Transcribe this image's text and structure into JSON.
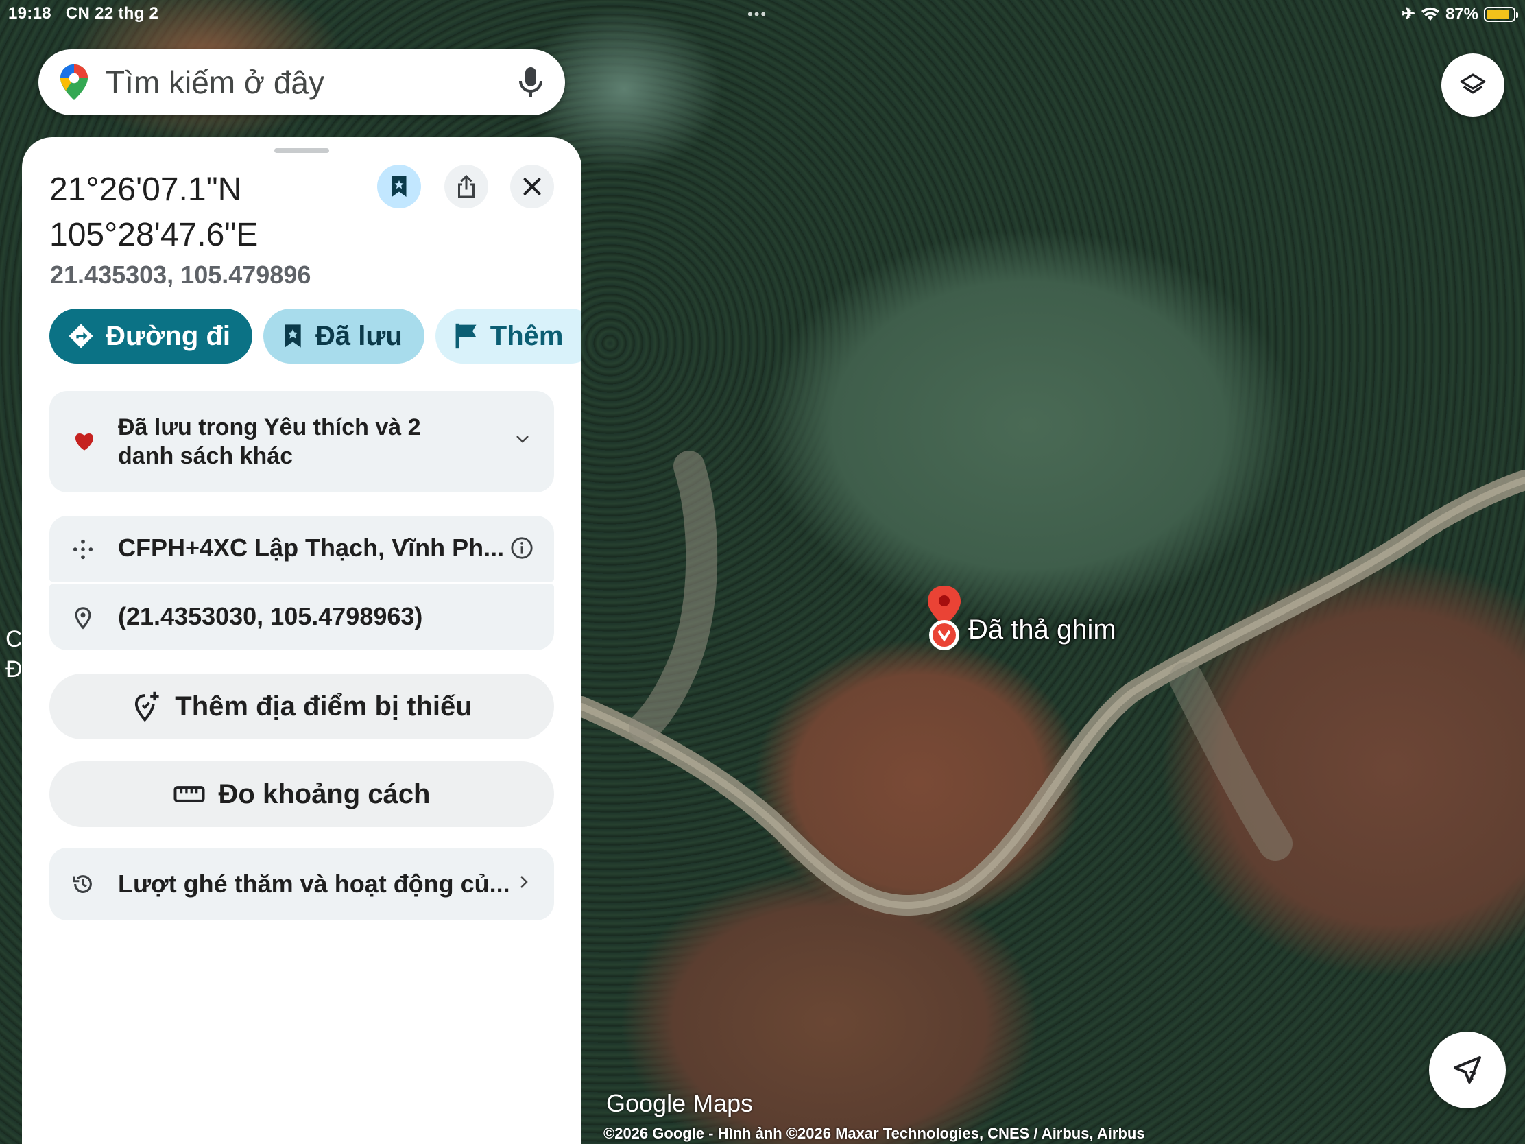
{
  "status_bar": {
    "time": "19:18",
    "date": "CN 22 thg 2",
    "dots": "•••",
    "battery": "87%",
    "battery_level": 0.87
  },
  "search": {
    "placeholder": "Tìm kiếm ở đây"
  },
  "place": {
    "title_line1": "21°26'07.1\"N",
    "title_line2": "105°28'47.6\"E",
    "decimal_coords": "21.435303, 105.479896"
  },
  "chips": {
    "directions": "Đường đi",
    "saved": "Đã lưu",
    "more": "Thêm"
  },
  "saved_lists": {
    "text": "Đã lưu trong Yêu thích và 2 danh sách khác"
  },
  "details": {
    "plus_code": "CFPH+4XC Lập Thạch, Vĩnh Ph...",
    "coordinates": "(21.4353030, 105.4798963)"
  },
  "actions": {
    "add_place": "Thêm địa điểm bị thiếu",
    "measure": "Đo khoảng cách"
  },
  "visits": {
    "text": "Lượt ghé thăm và hoạt động củ..."
  },
  "map": {
    "pin_label": "Đã thả ghim",
    "logo": "Google Maps",
    "copyright": "©2026 Google - Hình ảnh ©2026 Maxar Technologies, CNES / Airbus, Airbus",
    "left_edge_chars": [
      "C",
      "Đ"
    ]
  },
  "colors": {
    "accent": "#0b7285",
    "saved_chip": "#a8dcec",
    "pin": "#ea4335"
  },
  "icons": [
    "google-maps-pin-icon",
    "mic-icon",
    "layers-icon",
    "bookmark-icon",
    "share-icon",
    "close-icon",
    "directions-icon",
    "flag-icon",
    "heart-icon",
    "chevron-down-icon",
    "plus-code-icon",
    "location-pin-icon",
    "info-icon",
    "add-place-icon",
    "ruler-icon",
    "history-icon",
    "chevron-right-icon",
    "compass-icon"
  ]
}
